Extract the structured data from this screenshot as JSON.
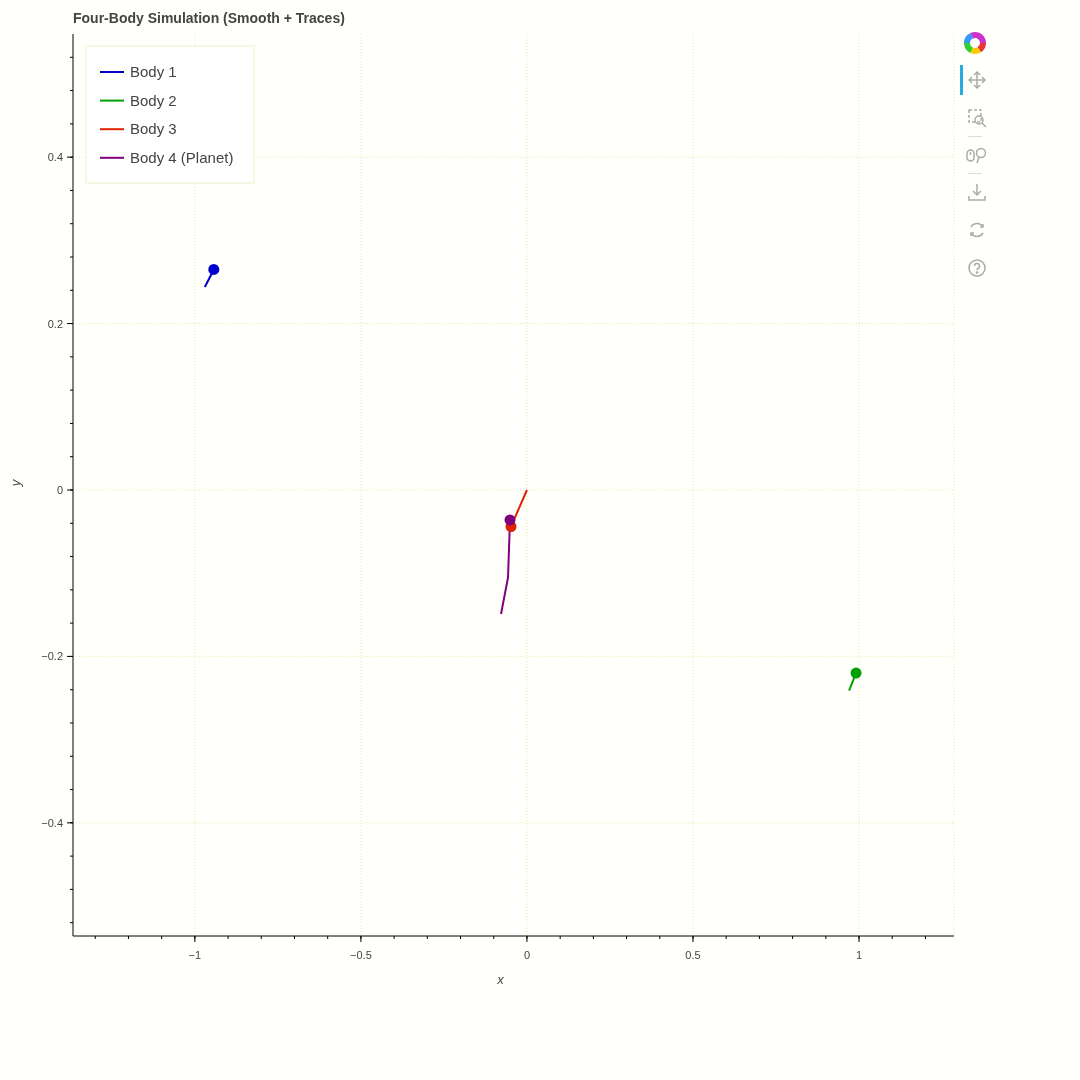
{
  "plot": {
    "title": "Four-Body Simulation (Smooth + Traces)",
    "chart_data": {
      "type": "line",
      "grid": true,
      "legend": true,
      "xlabel": "x",
      "ylabel": "y",
      "xlim": [
        -1.367,
        1.286
      ],
      "ylim": [
        -0.536,
        0.548
      ],
      "xticks": [
        {
          "value": -1,
          "label": "−1"
        },
        {
          "value": -0.5,
          "label": "−0.5"
        },
        {
          "value": 0,
          "label": "0"
        },
        {
          "value": 0.5,
          "label": "0.5"
        },
        {
          "value": 1,
          "label": "1"
        }
      ],
      "yticks": [
        {
          "value": -0.4,
          "label": "−0.4"
        },
        {
          "value": -0.2,
          "label": "−0.2"
        },
        {
          "value": 0,
          "label": "0"
        },
        {
          "value": 0.2,
          "label": "0.2"
        },
        {
          "value": 0.4,
          "label": "0.4"
        }
      ],
      "series": [
        {
          "name": "Body 1",
          "color": "#0000cc",
          "x": [
            -0.97,
            -0.943
          ],
          "values": [
            0.244,
            0.265
          ]
        },
        {
          "name": "Body 2",
          "color": "#00a000",
          "x": [
            0.97,
            0.991
          ],
          "values": [
            -0.241,
            -0.22
          ]
        },
        {
          "name": "Body 3",
          "color": "#dd2200",
          "x": [
            0,
            -0.048
          ],
          "values": [
            0,
            -0.044
          ]
        },
        {
          "name": "Body 4 (Planet)",
          "color": "#800080",
          "x": [
            -0.078,
            -0.057,
            -0.051
          ],
          "values": [
            -0.149,
            -0.105,
            -0.036
          ]
        }
      ]
    }
  },
  "toolbar": [
    {
      "kind": "logo"
    },
    {
      "kind": "pan",
      "selected": true
    },
    {
      "kind": "box-zoom",
      "selected": false
    },
    {
      "kind": "separator"
    },
    {
      "kind": "wheel-zoom",
      "selected": false
    },
    {
      "kind": "separator"
    },
    {
      "kind": "save"
    },
    {
      "kind": "reset"
    },
    {
      "kind": "help"
    }
  ]
}
